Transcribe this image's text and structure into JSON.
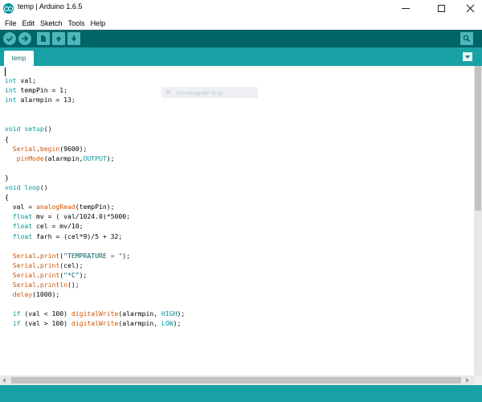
{
  "window": {
    "title": "temp | Arduino 1.6.5"
  },
  "menu": {
    "items": [
      {
        "label": "File"
      },
      {
        "label": "Edit"
      },
      {
        "label": "Sketch"
      },
      {
        "label": "Tools"
      },
      {
        "label": "Help"
      }
    ]
  },
  "toolbar": {
    "buttons": [
      {
        "icon": "checkmark-icon",
        "action": "verify"
      },
      {
        "icon": "arrow-right-icon",
        "action": "upload"
      },
      {
        "icon": "new-file-icon",
        "action": "new"
      },
      {
        "icon": "arrow-up-icon",
        "action": "open"
      },
      {
        "icon": "arrow-down-icon",
        "action": "save"
      },
      {
        "icon": "magnifier-icon",
        "action": "serial-monitor"
      }
    ]
  },
  "tabs": [
    {
      "label": "temp",
      "active": true
    }
  ],
  "overlay": {
    "snip_label": "Rectangular Snip"
  },
  "editor": {
    "lines": [
      "int val;",
      "int tempPin = 1;",
      "int alarmpin = 13;",
      "",
      "",
      "void setup()",
      "{",
      "  Serial.begin(9600);",
      "   pinMode(alarmpin,OUTPUT);",
      "",
      "}",
      "void loop()",
      "{",
      "  val = analogRead(tempPin);",
      "  float mv = ( val/1024.0)*5000;",
      "  float cel = mv/10;",
      "  float farh = (cel*9)/5 + 32;",
      "",
      "  Serial.print(\"TEMPRATURE = \");",
      "  Serial.print(cel);",
      "  Serial.print(\"*C\");",
      "  Serial.println();",
      "  delay(1000);",
      "",
      "  if (val < 100) digitalWrite(alarmpin, HIGH);",
      "  if (val > 100) digitalWrite(alarmpin, LOW);"
    ]
  },
  "colors": {
    "toolbar": "#006468",
    "tabstrip": "#17a1a5",
    "button": "#4db7bb",
    "keyword": "#00979c",
    "function": "#d35400"
  }
}
